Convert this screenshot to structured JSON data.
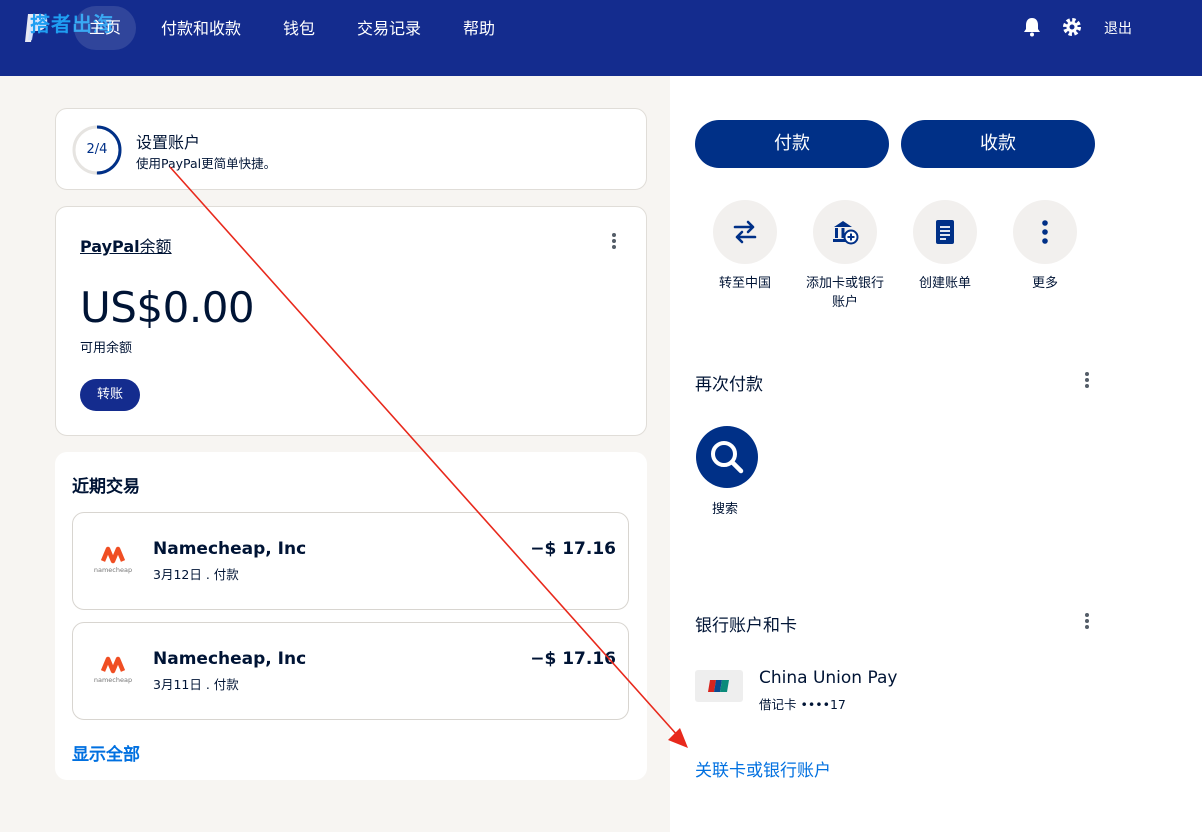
{
  "nav": {
    "watermark": "搭者出海",
    "home": "主页",
    "items": [
      "付款和收款",
      "钱包",
      "交易记录",
      "帮助"
    ],
    "logout": "退出"
  },
  "setup": {
    "progress_text": "2/4",
    "progress_fraction": 0.5,
    "title": "设置账户",
    "subtitle": "使用PayPal更简单快捷。"
  },
  "balance": {
    "title_brand": "PayPal",
    "title_suffix": "余额",
    "amount": "US$0.00",
    "label": "可用余额",
    "transfer": "转账"
  },
  "recent": {
    "title": "近期交易",
    "transactions": [
      {
        "name": "Namecheap, Inc",
        "date": "3月12日 . 付款",
        "amount": "−$ 17.16",
        "logo_text": "namecheap"
      },
      {
        "name": "Namecheap, Inc",
        "date": "3月11日 . 付款",
        "amount": "−$ 17.16",
        "logo_text": "namecheap"
      }
    ],
    "show_all": "显示全部"
  },
  "actions": {
    "pay": "付款",
    "receive": "收款"
  },
  "quick_actions": [
    {
      "label": "转至中国",
      "icon": "transfer-arrows-icon"
    },
    {
      "label": "添加卡或银行账户",
      "icon": "add-bank-icon"
    },
    {
      "label": "创建账单",
      "icon": "invoice-icon"
    },
    {
      "label": "更多",
      "icon": "more-icon"
    }
  ],
  "pay_again": {
    "title": "再次付款",
    "search_label": "搜索"
  },
  "banks": {
    "title": "银行账户和卡",
    "name": "China Union Pay",
    "detail": "借记卡 ••••17",
    "link": "关联卡或银行账户"
  },
  "colors": {
    "nav_bg": "#142c8e",
    "primary": "#003087",
    "link": "#0070e0",
    "annotation_arrow": "#e8291c"
  }
}
